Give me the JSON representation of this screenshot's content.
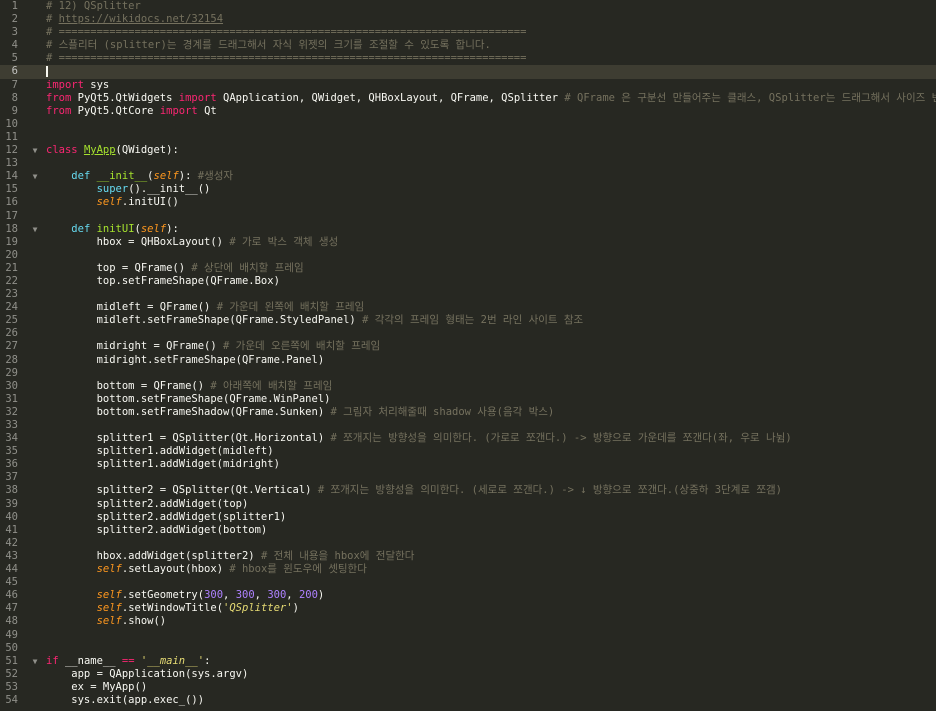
{
  "editor": {
    "cursor_line": 6,
    "lines": [
      {
        "n": "1",
        "tokens": [
          {
            "t": "# 12) QSplitter",
            "c": "comment"
          }
        ]
      },
      {
        "n": "2",
        "tokens": [
          {
            "t": "# ",
            "c": "comment"
          },
          {
            "t": "https://wikidocs.net/32154",
            "c": "link"
          }
        ]
      },
      {
        "n": "3",
        "tokens": [
          {
            "t": "# ==========================================================================",
            "c": "comment"
          }
        ]
      },
      {
        "n": "4",
        "tokens": [
          {
            "t": "# 스플리터 (splitter)는 경계를 드래그해서 자식 위젯의 크기를 조절할 수 있도록 합니다.",
            "c": "comment"
          }
        ]
      },
      {
        "n": "5",
        "tokens": [
          {
            "t": "# ==========================================================================",
            "c": "comment"
          }
        ]
      },
      {
        "n": "6",
        "tokens": []
      },
      {
        "n": "7",
        "tokens": [
          {
            "t": "import",
            "c": "kw"
          },
          {
            "t": " sys",
            "c": "plain"
          }
        ]
      },
      {
        "n": "8",
        "tokens": [
          {
            "t": "from",
            "c": "kw"
          },
          {
            "t": " PyQt5.QtWidgets ",
            "c": "plain"
          },
          {
            "t": "import",
            "c": "kw"
          },
          {
            "t": " QApplication, QWidget, QHBoxLayout, QFrame, QSplitter ",
            "c": "plain"
          },
          {
            "t": "# QFrame 은 구분선 만들어주는 클래스, QSplitter는 드래그해서 사이즈 변경",
            "c": "comment"
          }
        ]
      },
      {
        "n": "9",
        "tokens": [
          {
            "t": "from",
            "c": "kw"
          },
          {
            "t": " PyQt5.QtCore ",
            "c": "plain"
          },
          {
            "t": "import",
            "c": "kw"
          },
          {
            "t": " Qt",
            "c": "plain"
          }
        ]
      },
      {
        "n": "10",
        "tokens": []
      },
      {
        "n": "11",
        "tokens": []
      },
      {
        "n": "12",
        "fold": true,
        "tokens": [
          {
            "t": "class",
            "c": "kw"
          },
          {
            "t": " ",
            "c": "plain"
          },
          {
            "t": "MyApp",
            "c": "cls"
          },
          {
            "t": "(QWidget):",
            "c": "plain"
          }
        ]
      },
      {
        "n": "13",
        "tokens": []
      },
      {
        "n": "14",
        "fold": true,
        "tokens": [
          {
            "t": "    ",
            "c": "plain"
          },
          {
            "t": "def",
            "c": "builtin"
          },
          {
            "t": " ",
            "c": "plain"
          },
          {
            "t": "__init__",
            "c": "fn"
          },
          {
            "t": "(",
            "c": "plain"
          },
          {
            "t": "self",
            "c": "self"
          },
          {
            "t": "): ",
            "c": "plain"
          },
          {
            "t": "#생성자",
            "c": "comment"
          }
        ]
      },
      {
        "n": "15",
        "tokens": [
          {
            "t": "        ",
            "c": "plain"
          },
          {
            "t": "super",
            "c": "builtin"
          },
          {
            "t": "().__init__()",
            "c": "plain"
          }
        ]
      },
      {
        "n": "16",
        "tokens": [
          {
            "t": "        ",
            "c": "plain"
          },
          {
            "t": "self",
            "c": "self"
          },
          {
            "t": ".initUI()",
            "c": "plain"
          }
        ]
      },
      {
        "n": "17",
        "tokens": []
      },
      {
        "n": "18",
        "fold": true,
        "tokens": [
          {
            "t": "    ",
            "c": "plain"
          },
          {
            "t": "def",
            "c": "builtin"
          },
          {
            "t": " ",
            "c": "plain"
          },
          {
            "t": "initUI",
            "c": "fn"
          },
          {
            "t": "(",
            "c": "plain"
          },
          {
            "t": "self",
            "c": "self"
          },
          {
            "t": "):",
            "c": "plain"
          }
        ]
      },
      {
        "n": "19",
        "tokens": [
          {
            "t": "        hbox = QHBoxLayout() ",
            "c": "plain"
          },
          {
            "t": "# 가로 박스 객체 생성",
            "c": "comment"
          }
        ]
      },
      {
        "n": "20",
        "tokens": []
      },
      {
        "n": "21",
        "tokens": [
          {
            "t": "        top = QFrame() ",
            "c": "plain"
          },
          {
            "t": "# 상단에 배치할 프레임",
            "c": "comment"
          }
        ]
      },
      {
        "n": "22",
        "tokens": [
          {
            "t": "        top.setFrameShape(QFrame.Box)",
            "c": "plain"
          }
        ]
      },
      {
        "n": "23",
        "tokens": []
      },
      {
        "n": "24",
        "tokens": [
          {
            "t": "        midleft = QFrame() ",
            "c": "plain"
          },
          {
            "t": "# 가운데 왼쪽에 배치할 프레임",
            "c": "comment"
          }
        ]
      },
      {
        "n": "25",
        "tokens": [
          {
            "t": "        midleft.setFrameShape(QFrame.StyledPanel) ",
            "c": "plain"
          },
          {
            "t": "# 각각의 프레임 형태는 2번 라인 사이트 참조",
            "c": "comment"
          }
        ]
      },
      {
        "n": "26",
        "tokens": []
      },
      {
        "n": "27",
        "tokens": [
          {
            "t": "        midright = QFrame() ",
            "c": "plain"
          },
          {
            "t": "# 가운데 오른쪽에 배치할 프레임",
            "c": "comment"
          }
        ]
      },
      {
        "n": "28",
        "tokens": [
          {
            "t": "        midright.setFrameShape(QFrame.Panel)",
            "c": "plain"
          }
        ]
      },
      {
        "n": "29",
        "tokens": []
      },
      {
        "n": "30",
        "tokens": [
          {
            "t": "        bottom = QFrame() ",
            "c": "plain"
          },
          {
            "t": "# 아래쪽에 배치할 프레임",
            "c": "comment"
          }
        ]
      },
      {
        "n": "31",
        "tokens": [
          {
            "t": "        bottom.setFrameShape(QFrame.WinPanel)",
            "c": "plain"
          }
        ]
      },
      {
        "n": "32",
        "tokens": [
          {
            "t": "        bottom.setFrameShadow(QFrame.Sunken) ",
            "c": "plain"
          },
          {
            "t": "# 그림자 처리해줄때 shadow 사용(음각 박스)",
            "c": "comment"
          }
        ]
      },
      {
        "n": "33",
        "tokens": []
      },
      {
        "n": "34",
        "tokens": [
          {
            "t": "        splitter1 = QSplitter(Qt.Horizontal) ",
            "c": "plain"
          },
          {
            "t": "# 쪼개지는 방향성을 의미한다. (가로로 쪼갠다.) -> 방향으로 가운데를 쪼갠다(좌, 우로 나뉨)",
            "c": "comment"
          }
        ]
      },
      {
        "n": "35",
        "tokens": [
          {
            "t": "        splitter1.addWidget(midleft)",
            "c": "plain"
          }
        ]
      },
      {
        "n": "36",
        "tokens": [
          {
            "t": "        splitter1.addWidget(midright)",
            "c": "plain"
          }
        ]
      },
      {
        "n": "37",
        "tokens": []
      },
      {
        "n": "38",
        "tokens": [
          {
            "t": "        splitter2 = QSplitter(Qt.Vertical) ",
            "c": "plain"
          },
          {
            "t": "# 쪼개지는 방향성을 의미한다. (세로로 쪼갠다.) -> ↓ 방향으로 쪼갠다.(상중하 3단계로 쪼갬)",
            "c": "comment"
          }
        ]
      },
      {
        "n": "39",
        "tokens": [
          {
            "t": "        splitter2.addWidget(top)",
            "c": "plain"
          }
        ]
      },
      {
        "n": "40",
        "tokens": [
          {
            "t": "        splitter2.addWidget(splitter1)",
            "c": "plain"
          }
        ]
      },
      {
        "n": "41",
        "tokens": [
          {
            "t": "        splitter2.addWidget(bottom)",
            "c": "plain"
          }
        ]
      },
      {
        "n": "42",
        "tokens": []
      },
      {
        "n": "43",
        "tokens": [
          {
            "t": "        hbox.addWidget(splitter2) ",
            "c": "plain"
          },
          {
            "t": "# 전체 내용을 hbox에 전달한다",
            "c": "comment"
          }
        ]
      },
      {
        "n": "44",
        "tokens": [
          {
            "t": "        ",
            "c": "plain"
          },
          {
            "t": "self",
            "c": "self"
          },
          {
            "t": ".setLayout(hbox) ",
            "c": "plain"
          },
          {
            "t": "# hbox를 윈도우에 셋팅한다",
            "c": "comment"
          }
        ]
      },
      {
        "n": "45",
        "tokens": []
      },
      {
        "n": "46",
        "tokens": [
          {
            "t": "        ",
            "c": "plain"
          },
          {
            "t": "self",
            "c": "self"
          },
          {
            "t": ".setGeometry(",
            "c": "plain"
          },
          {
            "t": "300",
            "c": "num"
          },
          {
            "t": ", ",
            "c": "plain"
          },
          {
            "t": "300",
            "c": "num"
          },
          {
            "t": ", ",
            "c": "plain"
          },
          {
            "t": "300",
            "c": "num"
          },
          {
            "t": ", ",
            "c": "plain"
          },
          {
            "t": "200",
            "c": "num"
          },
          {
            "t": ")",
            "c": "plain"
          }
        ]
      },
      {
        "n": "47",
        "tokens": [
          {
            "t": "        ",
            "c": "plain"
          },
          {
            "t": "self",
            "c": "self"
          },
          {
            "t": ".setWindowTitle(",
            "c": "plain"
          },
          {
            "t": "'QSplitter'",
            "c": "str-it"
          },
          {
            "t": ")",
            "c": "plain"
          }
        ]
      },
      {
        "n": "48",
        "tokens": [
          {
            "t": "        ",
            "c": "plain"
          },
          {
            "t": "self",
            "c": "self"
          },
          {
            "t": ".show()",
            "c": "plain"
          }
        ]
      },
      {
        "n": "49",
        "tokens": []
      },
      {
        "n": "50",
        "tokens": []
      },
      {
        "n": "51",
        "fold": true,
        "tokens": [
          {
            "t": "if",
            "c": "kw"
          },
          {
            "t": " __name__ ",
            "c": "plain"
          },
          {
            "t": "==",
            "c": "kw"
          },
          {
            "t": " ",
            "c": "plain"
          },
          {
            "t": "'__main__'",
            "c": "str-it"
          },
          {
            "t": ":",
            "c": "plain"
          }
        ]
      },
      {
        "n": "52",
        "tokens": [
          {
            "t": "    app = QApplication(sys.argv)",
            "c": "plain"
          }
        ]
      },
      {
        "n": "53",
        "tokens": [
          {
            "t": "    ex = MyApp()",
            "c": "plain"
          }
        ]
      },
      {
        "n": "54",
        "tokens": [
          {
            "t": "    sys.exit(app.exec_())",
            "c": "plain"
          }
        ]
      }
    ]
  }
}
